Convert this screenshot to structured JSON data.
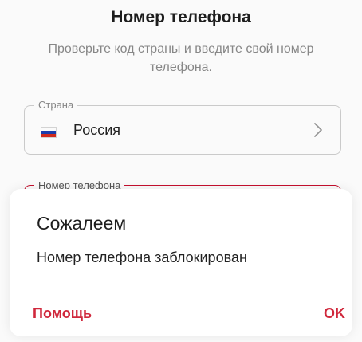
{
  "screen": {
    "title": "Номер телефона",
    "subtitle": "Проверьте код страны и введите свой номер телефона."
  },
  "country_field": {
    "label": "Страна",
    "value": "Россия",
    "flag_icon": "russia-flag-icon",
    "chevron_icon": "chevron-right-icon"
  },
  "phone_field": {
    "label": "Номер телефона",
    "border_color": "#c8102e"
  },
  "dialog": {
    "title": "Сожалеем",
    "message": "Номер телефона заблокирован",
    "help_label": "Помощь",
    "ok_label": "OK",
    "accent_color": "#d0283c"
  }
}
